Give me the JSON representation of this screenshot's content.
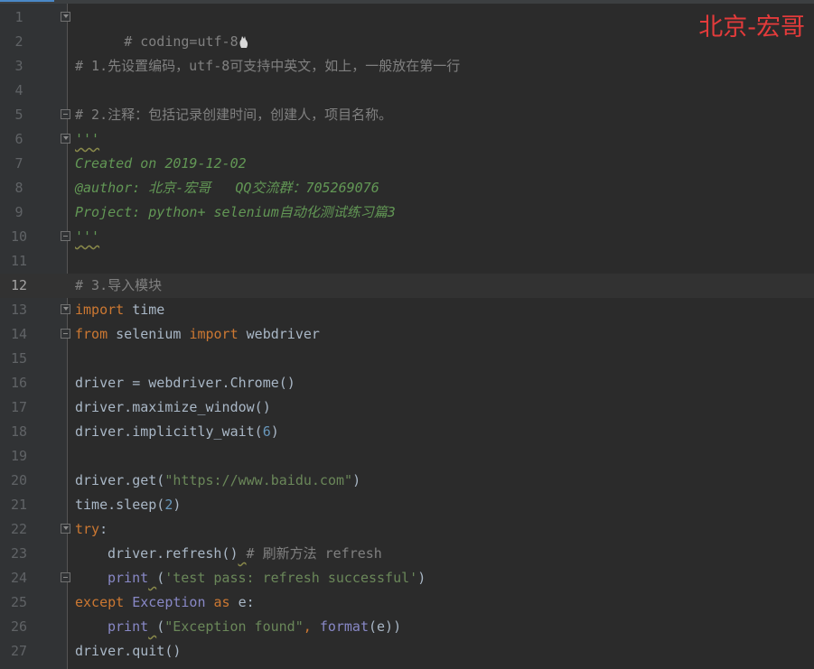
{
  "watermark": "北京-宏哥",
  "colors": {
    "background": "#2b2b2b",
    "gutter": "#313335",
    "keyword": "#cc7832",
    "string": "#6a8759",
    "comment": "#808080",
    "docstring": "#629755",
    "number": "#6897bb",
    "builtin": "#8888c6",
    "text": "#a9b7c6",
    "watermark": "#e33b3b"
  },
  "editor": {
    "current_line": "12",
    "lines": [
      {
        "n": "1",
        "code": [
          "# coding=utf-8"
        ]
      },
      {
        "n": "2",
        "code": []
      },
      {
        "n": "3",
        "code": [
          "# 1.先设置编码，utf-8可支持中英文，如上，一般放在第一行"
        ]
      },
      {
        "n": "4",
        "code": []
      },
      {
        "n": "5",
        "code": [
          "# 2.注释：包括记录创建时间，创建人，项目名称。"
        ]
      },
      {
        "n": "6",
        "code": [
          "'''"
        ]
      },
      {
        "n": "7",
        "code": [
          "Created on 2019-12-02"
        ]
      },
      {
        "n": "8",
        "code": [
          "@author: 北京-宏哥   QQ交流群：705269076"
        ]
      },
      {
        "n": "9",
        "code": [
          "Project: python+ selenium自动化测试练习篇3"
        ]
      },
      {
        "n": "10",
        "code": [
          "'''"
        ]
      },
      {
        "n": "11",
        "code": []
      },
      {
        "n": "12",
        "code": [
          "# 3.导入模块"
        ]
      },
      {
        "n": "13",
        "code": [
          "import",
          " time"
        ]
      },
      {
        "n": "14",
        "code": [
          "from",
          " selenium ",
          "import",
          " webdriver"
        ]
      },
      {
        "n": "15",
        "code": []
      },
      {
        "n": "16",
        "code": [
          "driver = webdriver.Chrome()"
        ]
      },
      {
        "n": "17",
        "code": [
          "driver.maximize_window()"
        ]
      },
      {
        "n": "18",
        "code": [
          "driver.implicitly_wait(",
          "6",
          ")"
        ]
      },
      {
        "n": "19",
        "code": []
      },
      {
        "n": "20",
        "code": [
          "driver.get(",
          "\"https://www.baidu.com\"",
          ")"
        ]
      },
      {
        "n": "21",
        "code": [
          "time.sleep(",
          "2",
          ")"
        ]
      },
      {
        "n": "22",
        "code": [
          "try",
          ":"
        ]
      },
      {
        "n": "23",
        "code": [
          "driver.refresh()",
          " ",
          "# 刷新方法 refresh"
        ]
      },
      {
        "n": "24",
        "code": [
          "print",
          " ",
          "(",
          "'test pass: refresh successful'",
          ")"
        ]
      },
      {
        "n": "25",
        "code": [
          "except",
          " ",
          "Exception",
          " ",
          "as",
          " e:"
        ]
      },
      {
        "n": "26",
        "code": [
          "print",
          " ",
          "(",
          "\"Exception found\"",
          ", ",
          "format",
          "(e))"
        ]
      },
      {
        "n": "27",
        "code": [
          "driver.quit()"
        ]
      }
    ]
  }
}
